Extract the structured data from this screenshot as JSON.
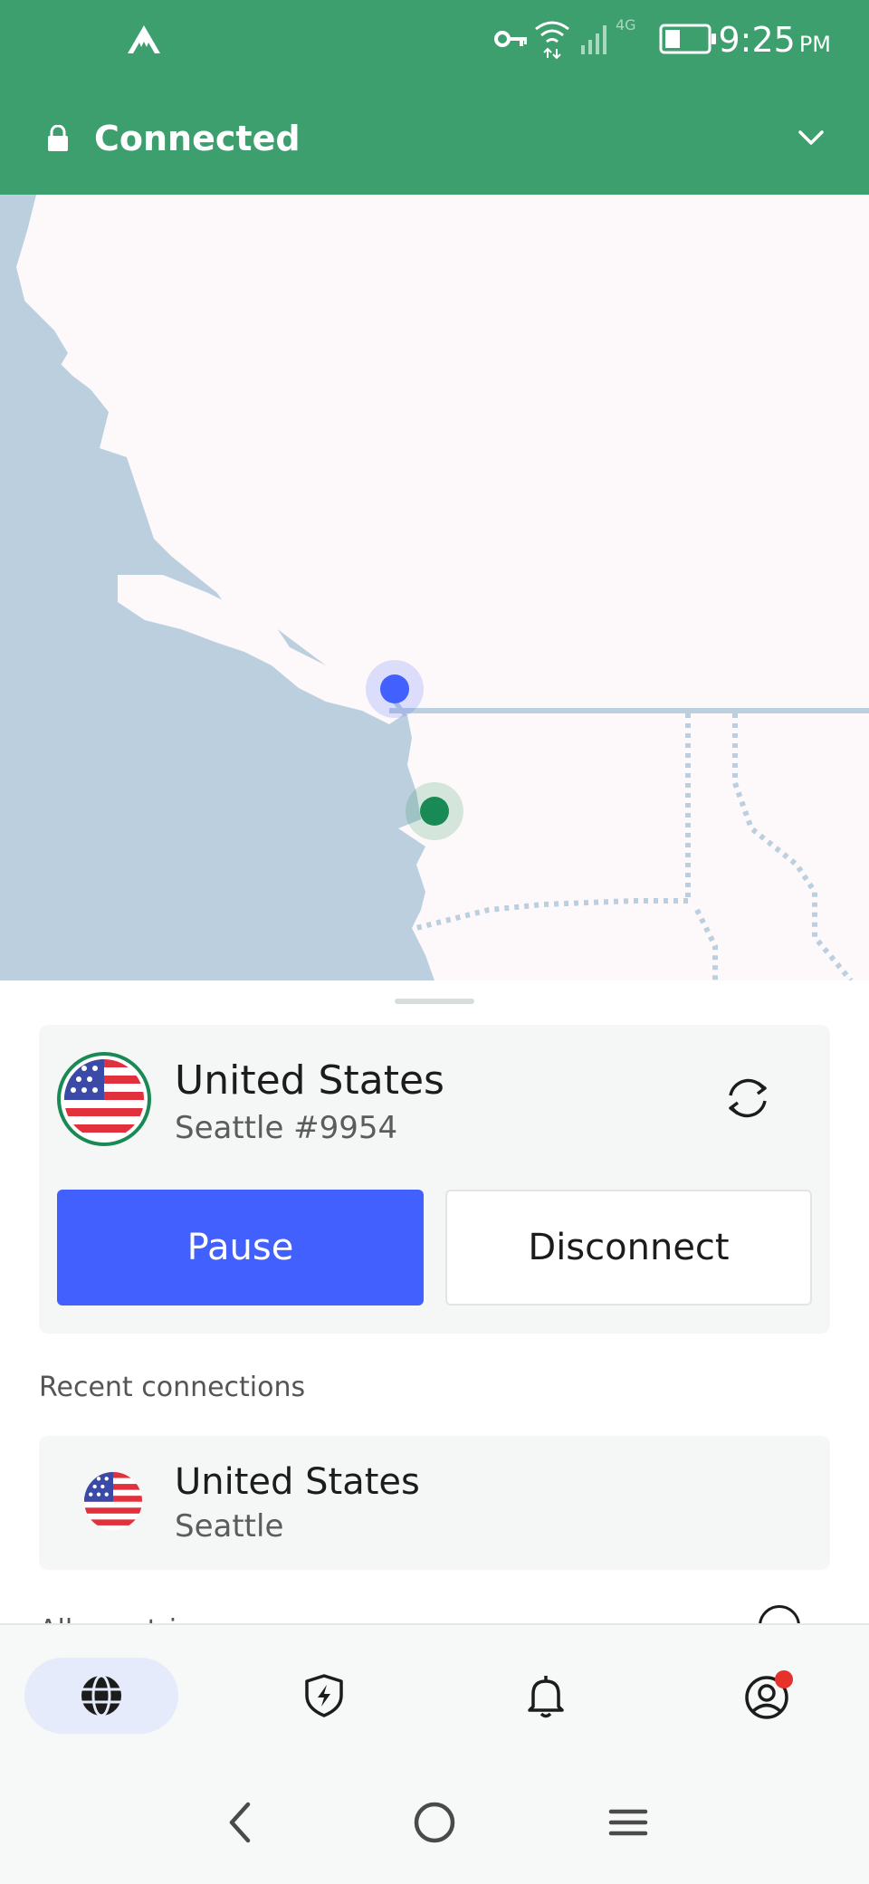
{
  "status_bar": {
    "time": "9:25",
    "ampm": "PM",
    "network": "4G",
    "icons": [
      "nordvpn-logo-icon",
      "vpn-key-icon",
      "wifi-icon",
      "signal-icon",
      "battery-icon"
    ]
  },
  "header": {
    "status": "Connected",
    "lock_icon": "lock-icon",
    "expand_icon": "chevron-down-icon"
  },
  "map": {
    "markers": [
      "server-location-marker",
      "user-location-marker"
    ],
    "colors": {
      "water": "#bccfdf",
      "land": "#fdf9fb",
      "server_marker": "#4160fe",
      "user_marker": "#198a55"
    }
  },
  "connection": {
    "country": "United States",
    "server": "Seattle #9954",
    "flag_icon": "us-flag-icon",
    "refresh_icon": "refresh-icon",
    "pause_label": "Pause",
    "disconnect_label": "Disconnect"
  },
  "recent": {
    "title": "Recent connections",
    "items": [
      {
        "country": "United States",
        "city": "Seattle",
        "flag_icon": "us-flag-icon"
      }
    ]
  },
  "peek_text": "All countries",
  "bottom_nav": {
    "items": [
      {
        "icon": "globe-icon",
        "active": true
      },
      {
        "icon": "shield-bolt-icon",
        "active": false
      },
      {
        "icon": "bell-icon",
        "active": false
      },
      {
        "icon": "profile-icon",
        "active": false,
        "badge": true
      }
    ]
  },
  "system_nav": [
    "back-icon",
    "home-icon",
    "menu-icon"
  ],
  "theme": {
    "green": "#3d9e6e",
    "blue": "#4160fe",
    "badge": "#e5322c"
  }
}
